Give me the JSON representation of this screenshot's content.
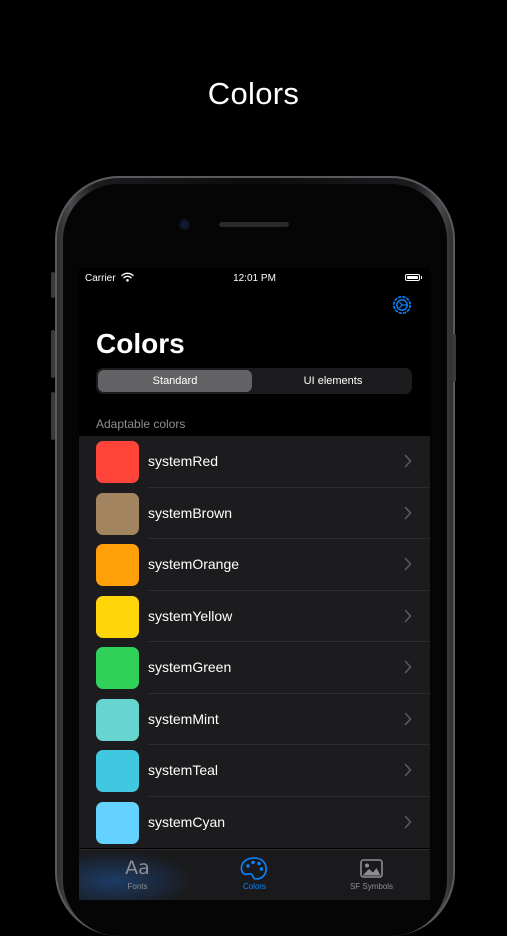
{
  "promo": {
    "title": "Colors"
  },
  "status_bar": {
    "carrier": "Carrier",
    "time": "12:01 PM"
  },
  "navigation": {
    "title": "Colors",
    "settings_icon": "gear-icon"
  },
  "segmented_control": {
    "options": [
      "Standard",
      "UI elements"
    ],
    "selected": "Standard"
  },
  "section": {
    "header": "Adaptable colors"
  },
  "colors": [
    {
      "name": "systemRed",
      "hex": "#ff453a"
    },
    {
      "name": "systemBrown",
      "hex": "#a2845e"
    },
    {
      "name": "systemOrange",
      "hex": "#ff9f0a"
    },
    {
      "name": "systemYellow",
      "hex": "#ffd60a"
    },
    {
      "name": "systemGreen",
      "hex": "#30d158"
    },
    {
      "name": "systemMint",
      "hex": "#66d4cf"
    },
    {
      "name": "systemTeal",
      "hex": "#40c8e0"
    },
    {
      "name": "systemCyan",
      "hex": "#64d2ff"
    }
  ],
  "tab_bar": {
    "tabs": [
      {
        "label": "Fonts",
        "icon": "aa-icon",
        "active": false
      },
      {
        "label": "Colors",
        "icon": "palette-icon",
        "active": true
      },
      {
        "label": "SF Symbols",
        "icon": "photo-icon",
        "active": false
      }
    ],
    "accent": "#0a84ff"
  }
}
